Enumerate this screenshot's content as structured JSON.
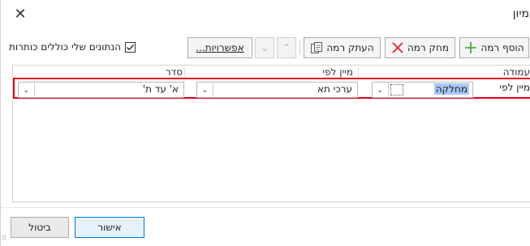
{
  "dialog": {
    "title": "מיון",
    "close_glyph": "✕"
  },
  "toolbar": {
    "add_level_label": "הוסף רמה",
    "add_level_icon": "plus-icon",
    "delete_level_label": "מחק רמה",
    "delete_level_icon": "red-x-icon",
    "copy_level_label": "העתק רמה",
    "copy_level_icon": "copy-icon",
    "move_up_glyph": "⌃",
    "move_down_glyph": "⌄",
    "options_label": "אפשרויות...",
    "headers_checkbox_label": "הנתונים שלי כוללים כותרות",
    "headers_checkbox_checked": true
  },
  "colors": {
    "plus_green": "#2e9e2e",
    "delete_red": "#d9263b",
    "highlight_border": "#e0001c",
    "selection_blue": "#a9c8f5",
    "default_button_border": "#0078d7"
  },
  "table": {
    "headers": {
      "column": "עמודה",
      "sort_on": "מיין לפי",
      "order": "סדר"
    },
    "rows": [
      {
        "label": "מיין לפי",
        "column_value": "מחלקה",
        "sort_on_value": "ערכי תא",
        "order_value": "א' עד ת'"
      }
    ]
  },
  "footer": {
    "ok_label": "אישור",
    "cancel_label": "ביטול"
  }
}
